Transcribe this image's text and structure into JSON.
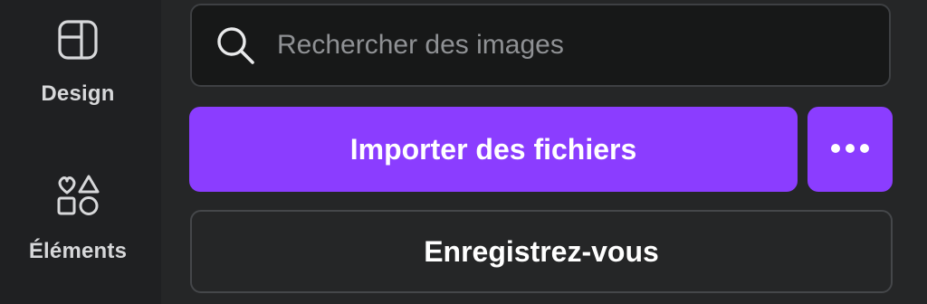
{
  "sidebar": {
    "items": [
      {
        "label": "Design",
        "icon": "layout-icon"
      },
      {
        "label": "Éléments",
        "icon": "shapes-icon"
      }
    ]
  },
  "search": {
    "placeholder": "Rechercher des images",
    "value": "",
    "icon": "search-icon"
  },
  "actions": {
    "import_label": "Importer des fichiers",
    "more_icon": "more-icon",
    "register_label": "Enregistrez-vous"
  },
  "colors": {
    "background": "#252627",
    "sidebar": "#1f2022",
    "accent": "#8b3dff",
    "search_bg": "#171818",
    "text": "#ffffff",
    "muted_text": "#8f9194"
  }
}
